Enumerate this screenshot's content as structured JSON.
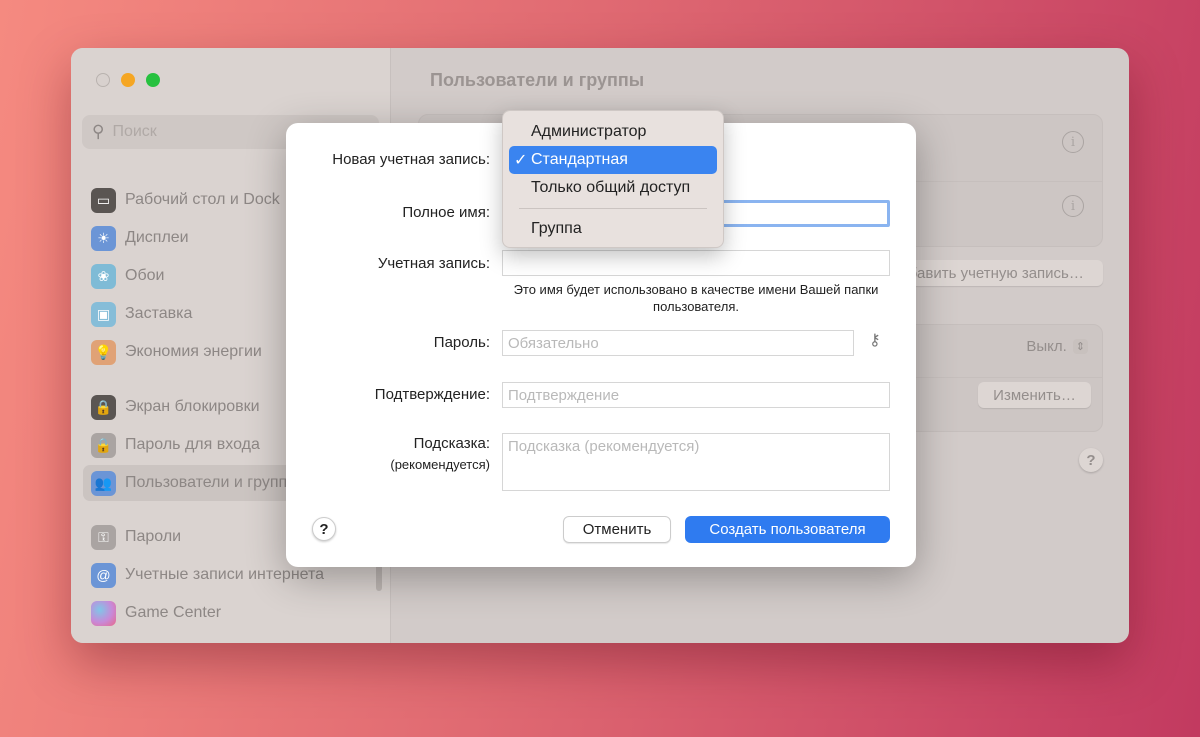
{
  "window": {
    "title": "Пользователи и группы"
  },
  "sidebar": {
    "search_placeholder": "Поиск",
    "items": [
      {
        "label": "Рабочий стол и Dock",
        "icon": "desktop-dock-icon",
        "color": "#4a4a4a"
      },
      {
        "label": "Дисплеи",
        "icon": "display-sun-icon",
        "color": "#3d86e8"
      },
      {
        "label": "Обои",
        "icon": "wallpaper-flower-icon",
        "color": "#52b6e0"
      },
      {
        "label": "Заставка",
        "icon": "screensaver-icon",
        "color": "#5cb6e2"
      },
      {
        "label": "Экономия энергии",
        "icon": "lightbulb-icon",
        "color": "#f08c3a"
      },
      {
        "label": "Экран блокировки",
        "icon": "lock-screen-icon",
        "color": "#3a3a3a"
      },
      {
        "label": "Пароль для входа",
        "icon": "lock-icon",
        "color": "#9a9a9a"
      },
      {
        "label": "Пользователи и группы",
        "icon": "users-icon",
        "color": "#3d86e8",
        "selected": true
      },
      {
        "label": "Пароли",
        "icon": "key-icon",
        "color": "#9a9a9a"
      },
      {
        "label": "Учетные записи интернета",
        "icon": "at-icon",
        "color": "#3d86e8"
      },
      {
        "label": "Game Center",
        "icon": "game-center-icon",
        "color": "#e85a8a"
      }
    ]
  },
  "main": {
    "add_account_button": "Добавить учетную запись…",
    "auto_login_value": "Выкл.",
    "change_button": "Изменить…"
  },
  "dialog": {
    "new_account_label": "Новая учетная запись:",
    "full_name_label": "Полное имя:",
    "full_name_value": "",
    "account_label": "Учетная запись:",
    "account_value": "",
    "account_note": "Это имя будет использовано в качестве имени Вашей папки пользователя.",
    "password_label": "Пароль:",
    "password_placeholder": "Обязательно",
    "confirm_label": "Подтверждение:",
    "confirm_placeholder": "Подтверждение",
    "hint_label": "Подсказка:",
    "hint_sublabel": "(рекомендуется)",
    "hint_placeholder": "Подсказка (рекомендуется)",
    "cancel_button": "Отменить",
    "create_button": "Создать пользователя",
    "help": "?"
  },
  "account_type_menu": {
    "options": [
      "Администратор",
      "Стандартная",
      "Только общий доступ",
      "Группа"
    ],
    "selected": "Стандартная",
    "check": "✓"
  },
  "colors": {
    "accent": "#2f7bf0",
    "close": "#d8d1ce",
    "minimize": "#f5a623",
    "zoom": "#27c13f"
  }
}
